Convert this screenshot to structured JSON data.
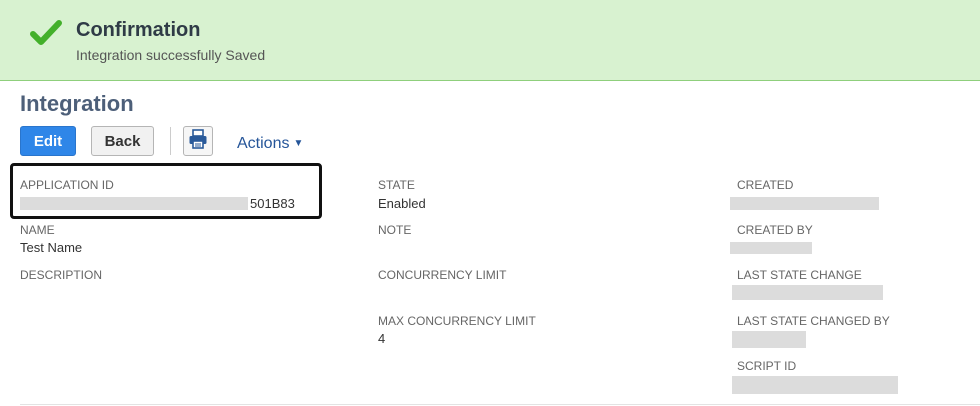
{
  "confirmation": {
    "title": "Confirmation",
    "message": "Integration successfully Saved",
    "icon": "check-icon",
    "icon_color": "#43b02a",
    "background": "#d8f2d0"
  },
  "page": {
    "title": "Integration"
  },
  "toolbar": {
    "edit_label": "Edit",
    "back_label": "Back",
    "print_icon": "print-icon",
    "actions_label": "Actions"
  },
  "fields": {
    "application_id": {
      "label": "APPLICATION ID",
      "value": "501B83"
    },
    "name": {
      "label": "NAME",
      "value": "Test Name"
    },
    "description": {
      "label": "DESCRIPTION",
      "value": ""
    },
    "state": {
      "label": "STATE",
      "value": "Enabled"
    },
    "note": {
      "label": "NOTE",
      "value": ""
    },
    "concurrency_limit": {
      "label": "CONCURRENCY LIMIT",
      "value": ""
    },
    "max_concurrency_limit": {
      "label": "MAX CONCURRENCY LIMIT",
      "value": "4"
    },
    "created": {
      "label": "CREATED",
      "value": ""
    },
    "created_by": {
      "label": "CREATED BY",
      "value": ""
    },
    "last_state_change": {
      "label": "LAST STATE CHANGE",
      "value": ""
    },
    "last_state_changed_by": {
      "label": "LAST STATE CHANGED BY",
      "value": ""
    },
    "script_id": {
      "label": "SCRIPT ID",
      "value": ""
    }
  },
  "colors": {
    "primary_button": "#2f86e8",
    "title": "#4d5f79",
    "link": "#255599"
  }
}
